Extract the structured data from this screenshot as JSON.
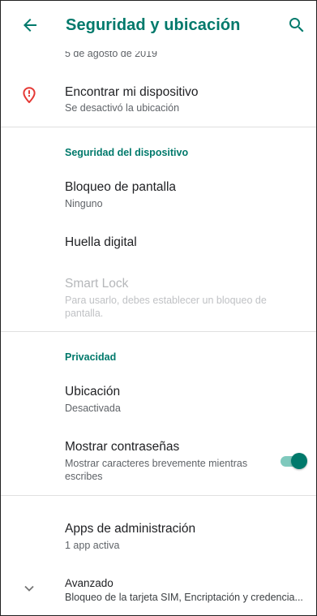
{
  "appbar": {
    "title": "Seguridad y ubicación",
    "back_icon": "arrow-left-icon",
    "search_icon": "search-icon"
  },
  "colors": {
    "accent": "#00796b",
    "accent_light": "#7fc9bd",
    "alert_red": "#e53935"
  },
  "partial_item": {
    "subtitle": "5 de agosto de 2019"
  },
  "find_device": {
    "title": "Encontrar mi dispositivo",
    "subtitle": "Se desactivó la ubicación",
    "icon": "location-alert-icon"
  },
  "device_security": {
    "header": "Seguridad del dispositivo",
    "screen_lock": {
      "title": "Bloqueo de pantalla",
      "subtitle": "Ninguno"
    },
    "fingerprint": {
      "title": "Huella digital"
    },
    "smart_lock": {
      "title": "Smart Lock",
      "subtitle": "Para usarlo, debes establecer un bloqueo de pantalla."
    }
  },
  "privacy": {
    "header": "Privacidad",
    "location": {
      "title": "Ubicación",
      "subtitle": "Desactivada"
    },
    "show_passwords": {
      "title": "Mostrar contraseñas",
      "subtitle": "Mostrar caracteres brevemente mientras escribes",
      "enabled": true
    }
  },
  "admin_apps": {
    "title": "Apps de administración",
    "subtitle": "1 app activa"
  },
  "advanced": {
    "title": "Avanzado",
    "subtitle": "Bloqueo de la tarjeta SIM, Encriptación y credencia...",
    "icon": "chevron-down-icon"
  }
}
